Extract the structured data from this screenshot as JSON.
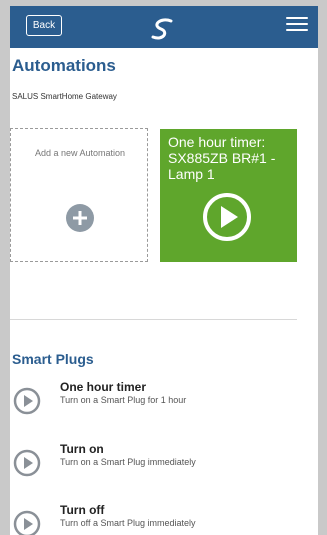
{
  "header": {
    "back_label": "Back",
    "logo_icon": "salus-logo-icon",
    "menu_icon": "hamburger-menu-icon"
  },
  "page": {
    "title": "Automations",
    "subtitle": "SALUS SmartHome Gateway"
  },
  "cards": {
    "add_label": "Add a new Automation",
    "add_icon": "plus-icon",
    "timer_title": "One hour timer: SX885ZB BR#1 - Lamp 1",
    "timer_icon": "play-icon",
    "timer_color": "#5fa62c"
  },
  "smart_plugs": {
    "title": "Smart Plugs",
    "items": [
      {
        "name": "One hour timer",
        "description": "Turn on a Smart Plug for 1 hour",
        "icon": "play-icon"
      },
      {
        "name": "Turn on",
        "description": "Turn on a Smart Plug immediately",
        "icon": "play-icon"
      },
      {
        "name": "Turn off",
        "description": "Turn off a Smart Plug immediately",
        "icon": "play-icon"
      }
    ]
  },
  "colors": {
    "brand": "#2b5d8f",
    "accent_green": "#5fa62c"
  }
}
